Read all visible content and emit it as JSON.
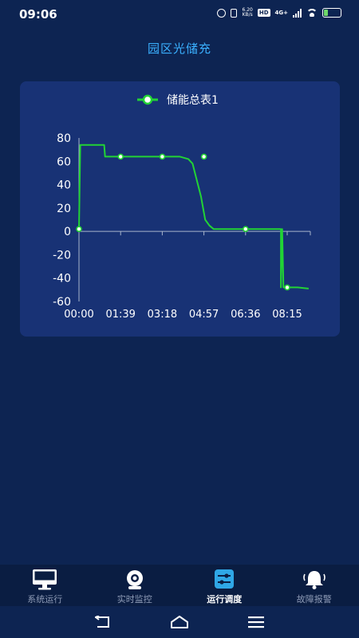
{
  "status_bar": {
    "time": "09:06",
    "speed_value": "6.20",
    "speed_unit": "KB/s",
    "hd_badge": "HD",
    "network": "4G+",
    "battery_level": "26",
    "battery_fraction": 0.26
  },
  "page": {
    "title": "园区光储充"
  },
  "chart_data": {
    "type": "line",
    "legend": [
      "储能总表1"
    ],
    "legend_placement": "top-center",
    "x_ticks": [
      "00:00",
      "01:39",
      "03:18",
      "04:57",
      "06:36",
      "08:15"
    ],
    "y_ticks": [
      80,
      60,
      40,
      20,
      0,
      -20,
      -40,
      -60
    ],
    "ylim": [
      -60,
      80
    ],
    "grid": false,
    "x_unit_minutes": true,
    "series": [
      {
        "name": "储能总表1",
        "color": "#22d335",
        "points": [
          [
            0,
            2
          ],
          [
            3,
            74
          ],
          [
            60,
            74
          ],
          [
            62,
            64
          ],
          [
            100,
            64
          ],
          [
            150,
            64
          ],
          [
            200,
            64
          ],
          [
            240,
            64
          ],
          [
            260,
            62
          ],
          [
            270,
            58
          ],
          [
            290,
            30
          ],
          [
            300,
            10
          ],
          [
            310,
            5
          ],
          [
            320,
            2
          ],
          [
            400,
            2
          ],
          [
            480,
            2
          ],
          [
            480,
            -48
          ],
          [
            483,
            2
          ],
          [
            486,
            -48
          ],
          [
            495,
            -48
          ],
          [
            520,
            -48
          ],
          [
            546,
            -49
          ]
        ],
        "markers": [
          [
            0,
            2
          ],
          [
            99,
            64
          ],
          [
            198,
            64
          ],
          [
            297,
            64
          ],
          [
            396,
            2
          ],
          [
            495,
            -48
          ]
        ]
      }
    ]
  },
  "bottom_nav": {
    "items": [
      {
        "label": "系统运行",
        "icon": "monitor-icon",
        "active": false
      },
      {
        "label": "实时监控",
        "icon": "camera-icon",
        "active": false
      },
      {
        "label": "运行调度",
        "icon": "sliders-icon",
        "active": true
      },
      {
        "label": "故障报警",
        "icon": "bell-icon",
        "active": false
      }
    ],
    "active_color": "#2fa7e6",
    "inactive_color": "#8e9bb6"
  },
  "system_nav": {
    "buttons": [
      "back-icon",
      "home-icon",
      "menu-icon"
    ]
  }
}
